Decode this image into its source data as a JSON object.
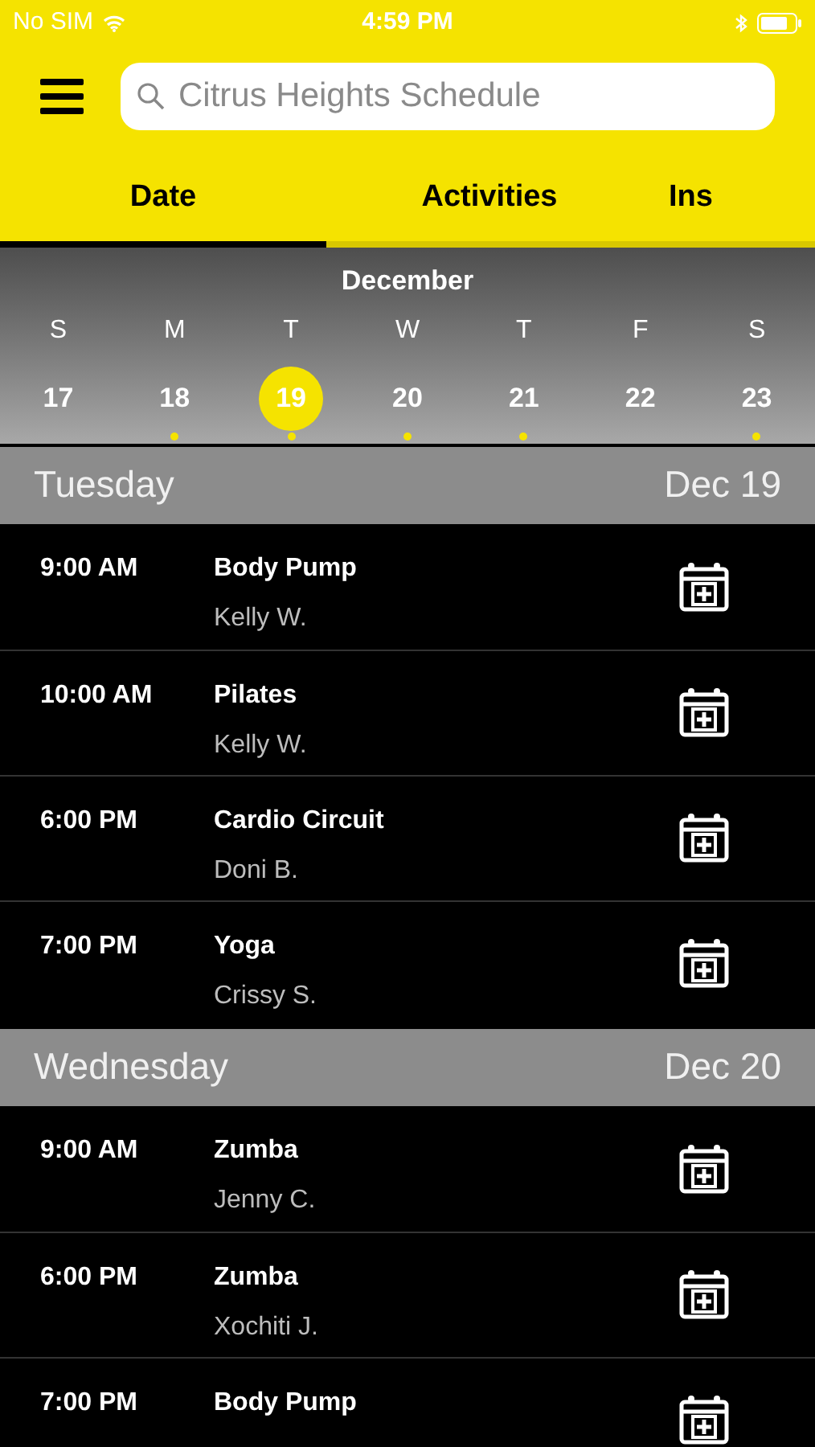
{
  "status_bar": {
    "carrier": "No SIM",
    "time": "4:59 PM"
  },
  "search": {
    "placeholder": "Citrus Heights Schedule"
  },
  "tabs": [
    {
      "label": "Date",
      "selected": true
    },
    {
      "label": "Activities",
      "selected": false
    },
    {
      "label": "Ins",
      "selected": false
    }
  ],
  "calendar": {
    "month": "December",
    "days": [
      {
        "weekday": "S",
        "date": "17",
        "selected": false,
        "has_events": false
      },
      {
        "weekday": "M",
        "date": "18",
        "selected": false,
        "has_events": true
      },
      {
        "weekday": "T",
        "date": "19",
        "selected": true,
        "has_events": true
      },
      {
        "weekday": "W",
        "date": "20",
        "selected": false,
        "has_events": true
      },
      {
        "weekday": "T",
        "date": "21",
        "selected": false,
        "has_events": true
      },
      {
        "weekday": "F",
        "date": "22",
        "selected": false,
        "has_events": false
      },
      {
        "weekday": "S",
        "date": "23",
        "selected": false,
        "has_events": true
      }
    ]
  },
  "sections": [
    {
      "day": "Tuesday",
      "date": "Dec 19",
      "classes": [
        {
          "time": "9:00 AM",
          "name": "Body Pump",
          "instructor": "Kelly W."
        },
        {
          "time": "10:00 AM",
          "name": "Pilates",
          "instructor": "Kelly W."
        },
        {
          "time": "6:00 PM",
          "name": "Cardio Circuit",
          "instructor": "Doni B."
        },
        {
          "time": "7:00 PM",
          "name": "Yoga",
          "instructor": "Crissy S."
        }
      ]
    },
    {
      "day": "Wednesday",
      "date": "Dec 20",
      "classes": [
        {
          "time": "9:00 AM",
          "name": "Zumba",
          "instructor": "Jenny C."
        },
        {
          "time": "6:00 PM",
          "name": "Zumba",
          "instructor": "Xochiti J."
        },
        {
          "time": "7:00 PM",
          "name": "Body Pump"
        }
      ]
    }
  ]
}
